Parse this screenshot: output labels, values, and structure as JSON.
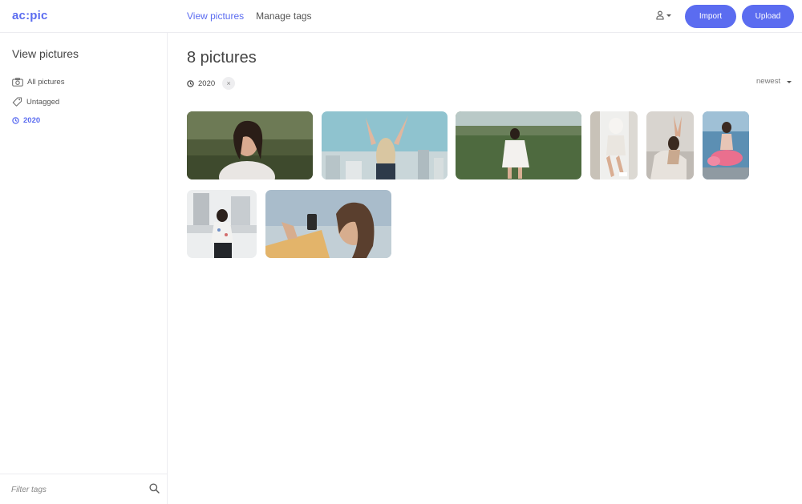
{
  "app": {
    "logo": "ac:pic"
  },
  "nav": {
    "view_pictures": "View pictures",
    "manage_tags": "Manage tags"
  },
  "header": {
    "import_label": "Import",
    "upload_label": "Upload",
    "user_icon": "user-icon"
  },
  "sidebar": {
    "title": "View pictures",
    "items": [
      {
        "label": "All pictures",
        "icon": "camera-icon"
      },
      {
        "label": "Untagged",
        "icon": "tag-icon"
      },
      {
        "label": "2020",
        "icon": "clock-icon"
      }
    ],
    "filter_placeholder": "Filter tags"
  },
  "main": {
    "title": "8 pictures",
    "active_filter": {
      "label": "2020",
      "remove": "×"
    },
    "sort": {
      "label": "newest"
    },
    "pictures": [
      {
        "description": "woman with eyes closed in a field"
      },
      {
        "description": "woman with arms raised over a city"
      },
      {
        "description": "woman in a white dress in a meadow"
      },
      {
        "description": "woman sitting on a white chair"
      },
      {
        "description": "woman stretching on a bed"
      },
      {
        "description": "woman in a pink skirt"
      },
      {
        "description": "woman on a rooftop"
      },
      {
        "description": "woman taking a selfie at the beach"
      }
    ]
  },
  "colors": {
    "accent": "#5b6cf0",
    "border": "#ececf0"
  }
}
